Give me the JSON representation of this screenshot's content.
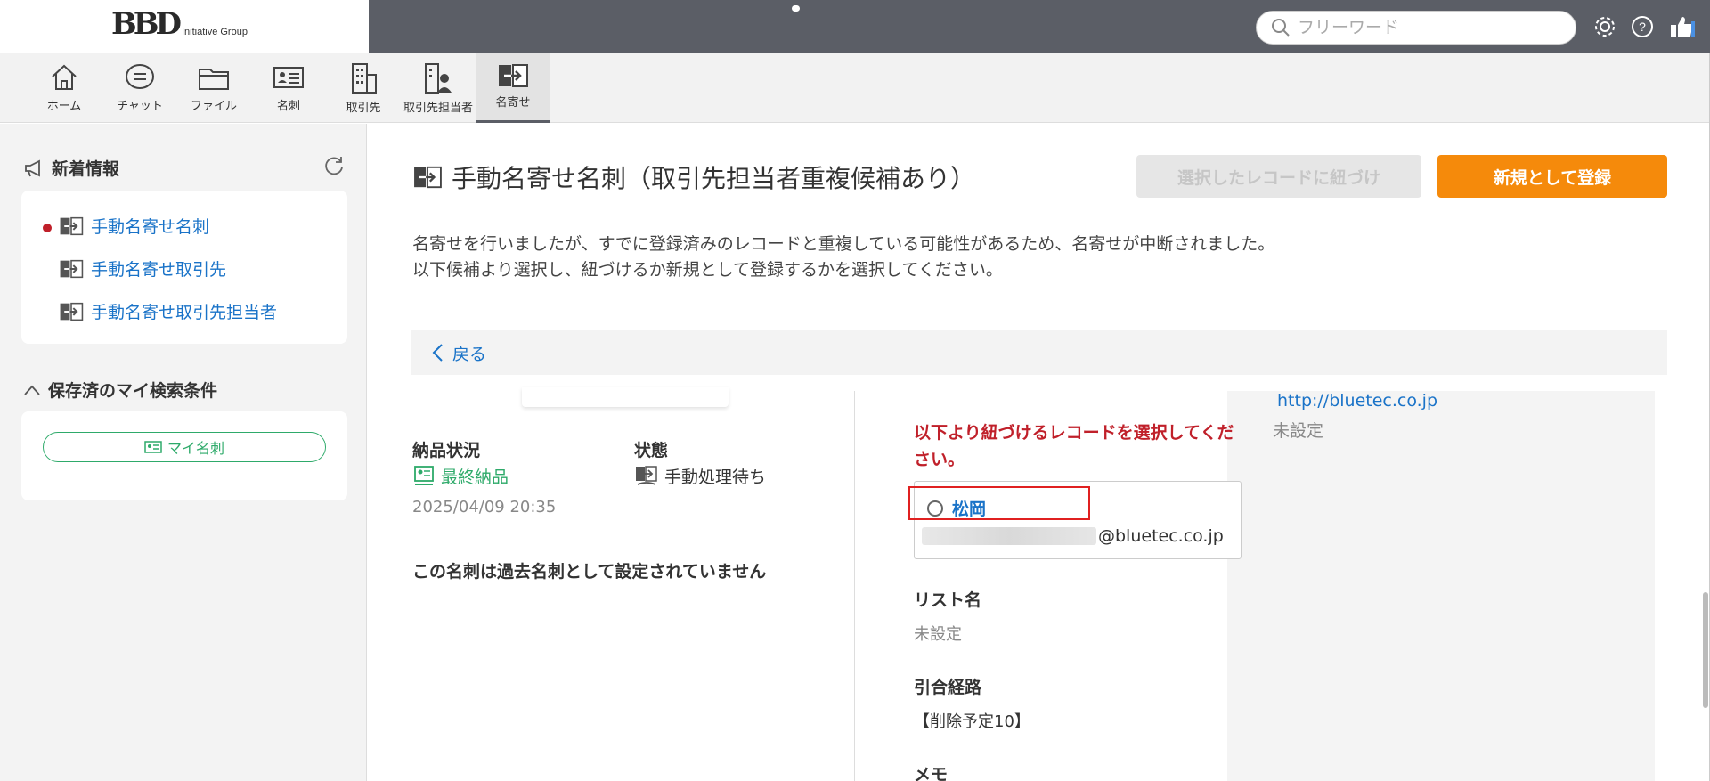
{
  "header": {
    "logo_mark": "BBD",
    "logo_sub": "Initiative Group",
    "search_placeholder": "フリーワード"
  },
  "nav": [
    {
      "label": "ホーム",
      "icon": "home-icon"
    },
    {
      "label": "チャット",
      "icon": "chat-icon"
    },
    {
      "label": "ファイル",
      "icon": "folder-icon"
    },
    {
      "label": "名刺",
      "icon": "business-card-icon"
    },
    {
      "label": "取引先",
      "icon": "building-icon"
    },
    {
      "label": "取引先担当者",
      "icon": "contact-person-icon"
    },
    {
      "label": "名寄せ",
      "icon": "merge-icon",
      "active": true
    }
  ],
  "sidebar": {
    "news_title": "新着情報",
    "news_items": [
      {
        "label": "手動名寄せ名刺",
        "unread": true
      },
      {
        "label": "手動名寄せ取引先",
        "unread": false
      },
      {
        "label": "手動名寄せ取引先担当者",
        "unread": false
      }
    ],
    "saved_title": "保存済のマイ検索条件",
    "my_card_button": "マイ名刺"
  },
  "main": {
    "title": "手動名寄せ名刺（取引先担当者重複候補あり）",
    "link_button": "選択したレコードに紐づけ",
    "new_button": "新規として登録",
    "description_line1": "名寄せを行いましたが、すでに登録済みのレコードと重複している可能性があるため、名寄せが中断されました。",
    "description_line2": "以下候補より選択し、紐づけるか新規として登録するかを選択してください。",
    "back_label": "戻る",
    "delivery_status_label": "納品状況",
    "delivery_status_value": "最終納品",
    "delivery_datetime": "2025/04/09 20:35",
    "state_label": "状態",
    "state_value": "手動処理待ち",
    "past_card_note": "この名刺は過去名刺として設定されていません",
    "select_message": "以下より紐づけるレコードを選択してください。",
    "candidate_name": "松岡",
    "candidate_email_domain": "@bluetec.co.jp",
    "list_name_label": "リスト名",
    "list_name_value": "未設定",
    "referral_label": "引合経路",
    "referral_value": "【削除予定10】",
    "memo_label": "メモ",
    "url_value": "http://bluetec.co.jp",
    "url_unset": "未設定"
  },
  "colors": {
    "accent_orange": "#f58a0b",
    "link_blue": "#1a73c8",
    "alert_red": "#c0202a",
    "green": "#2eaa6a",
    "topbar": "#5b5e66"
  }
}
